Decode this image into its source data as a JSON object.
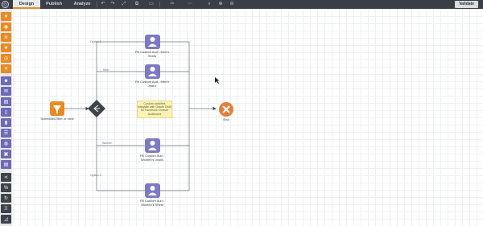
{
  "tabs": [
    {
      "label": "Design",
      "active": true
    },
    {
      "label": "Publish",
      "active": false
    },
    {
      "label": "Analyze",
      "active": false
    }
  ],
  "toolbar": {
    "validate_label": "Validate"
  },
  "canvas": {
    "start_node": {
      "label": "Scheduled filter or view"
    },
    "end_node": {
      "label": "End"
    },
    "paths": [
      {
        "label": "Option 1",
        "activity": "Fill Custom Aud - Men's Shirts"
      },
      {
        "label": "Men",
        "activity": "Fill Custom Aud - Men's Jeans"
      },
      {
        "label": "Women",
        "activity": "Fill Custom Aud - Women's Jeans"
      },
      {
        "label": "Option 2",
        "activity": "Fill Custom Aud - Women's Shirts"
      }
    ],
    "note": "Custom activities integrate with Oracle DMS for Facebook Custom Audiences"
  },
  "colors": {
    "accent_orange": "#e98a23",
    "activity_purple": "#7d79c2",
    "end_orange": "#e07f3c"
  }
}
